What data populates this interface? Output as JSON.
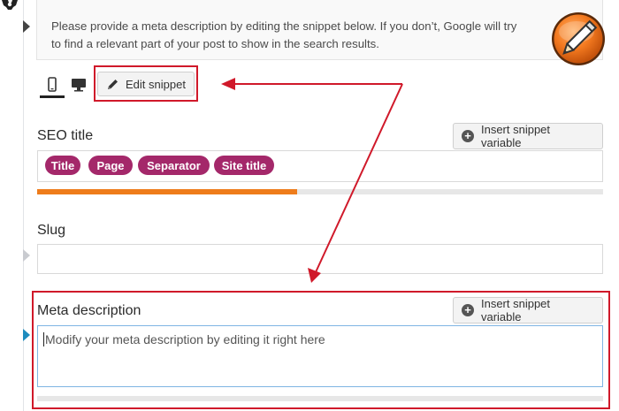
{
  "notice": {
    "line1": "Please provide a meta description by editing the snippet below. If you don’t, Google will try",
    "line2": "to find a relevant part of your post to show in the search results."
  },
  "preview": {
    "modes": [
      "mobile",
      "desktop"
    ],
    "active_mode": "mobile",
    "edit_snippet_label": "Edit snippet"
  },
  "seo_title": {
    "label": "SEO title",
    "insert_label": "Insert snippet variable",
    "variables": [
      "Title",
      "Page",
      "Separator",
      "Site title"
    ],
    "progress": 0.46,
    "progress_color": "#ee7c1b"
  },
  "slug": {
    "label": "Slug",
    "value": ""
  },
  "meta_description": {
    "label": "Meta description",
    "insert_label": "Insert snippet variable",
    "placeholder": "Modify your meta description by editing it right here"
  },
  "colors": {
    "pill": "#a4286a",
    "highlight": "#d0192a",
    "focus_border": "#7fb5e3"
  },
  "icons": [
    "gear-icon",
    "mobile-icon",
    "desktop-icon",
    "pencil-icon",
    "plus-circle-icon",
    "yoast-logo"
  ]
}
